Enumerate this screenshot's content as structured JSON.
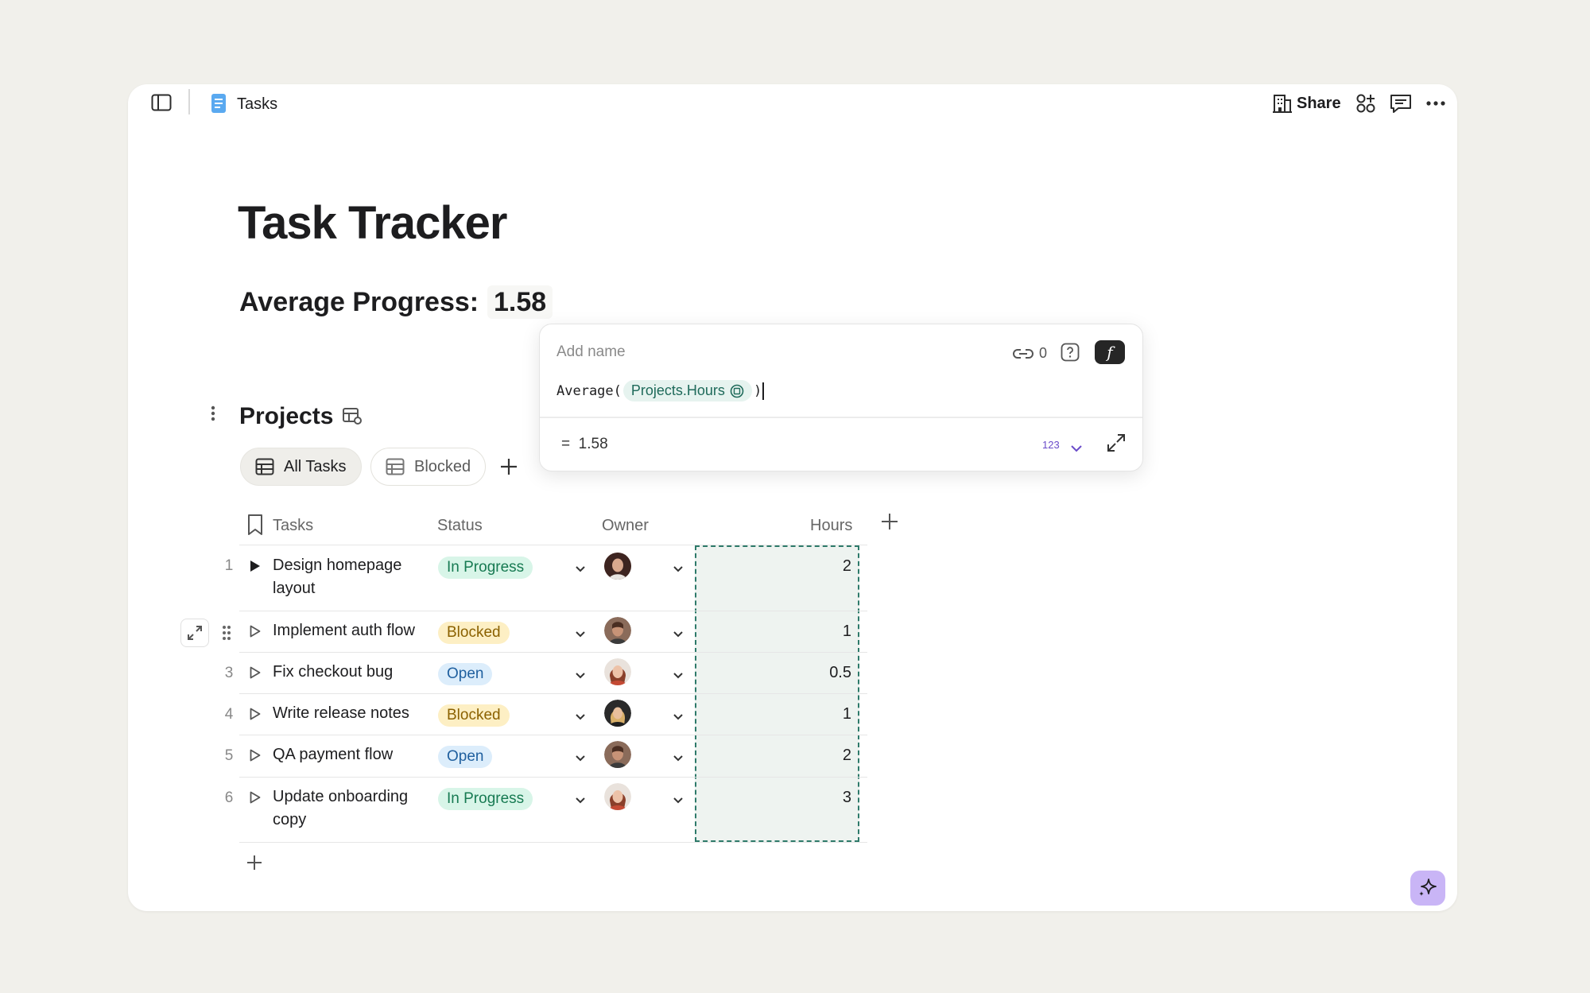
{
  "topbar": {
    "doc_name": "Tasks",
    "share_label": "Share"
  },
  "page": {
    "title": "Task Tracker",
    "average_label": "Average Progress:",
    "average_value": "1.58"
  },
  "section": {
    "title": "Projects"
  },
  "tabs": [
    {
      "label": "All Tasks",
      "active": true
    },
    {
      "label": "Blocked",
      "active": false
    }
  ],
  "table": {
    "headers": {
      "tasks": "Tasks",
      "status": "Status",
      "owner": "Owner",
      "hours": "Hours"
    },
    "rows": [
      {
        "num": "1",
        "task_line1": "Design homepage",
        "task_line2": "layout",
        "status": "In Progress",
        "hours": "2"
      },
      {
        "num": "",
        "task_line1": "Implement auth flow",
        "task_line2": "",
        "status": "Blocked",
        "hours": "1"
      },
      {
        "num": "3",
        "task_line1": "Fix checkout bug",
        "task_line2": "",
        "status": "Open",
        "hours": "0.5"
      },
      {
        "num": "4",
        "task_line1": "Write release notes",
        "task_line2": "",
        "status": "Blocked",
        "hours": "1"
      },
      {
        "num": "5",
        "task_line1": "QA payment flow",
        "task_line2": "",
        "status": "Open",
        "hours": "2"
      },
      {
        "num": "6",
        "task_line1": "Update onboarding",
        "task_line2": "copy",
        "status": "In Progress",
        "hours": "3"
      }
    ]
  },
  "formula_popup": {
    "name_placeholder": "Add name",
    "link_count": "0",
    "formula_fn": "Average(",
    "formula_ref": "Projects.Hours",
    "formula_close": ")",
    "result_eq": "=",
    "result_value": "1.58",
    "format_label": "123",
    "fn_button": "f"
  },
  "colors": {
    "accent_selection": "#2e7a6a",
    "in_progress_bg": "#d8f5e8",
    "blocked_bg": "#fdefc4",
    "open_bg": "#dcedfb",
    "ai_button": "#c9b5f6"
  }
}
